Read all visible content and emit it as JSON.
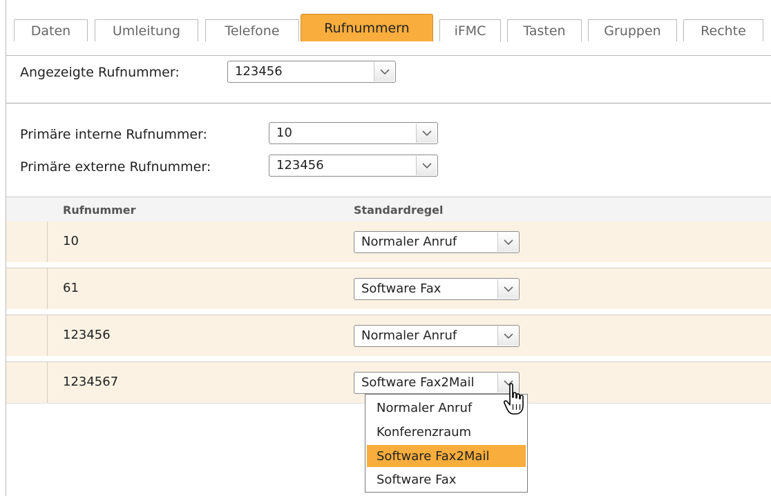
{
  "tabs": [
    {
      "label": "Daten"
    },
    {
      "label": "Umleitung"
    },
    {
      "label": "Telefone"
    },
    {
      "label": "Rufnummern",
      "active": true
    },
    {
      "label": "iFMC"
    },
    {
      "label": "Tasten"
    },
    {
      "label": "Gruppen"
    },
    {
      "label": "Rechte"
    }
  ],
  "displayed": {
    "label": "Angezeigte Rufnummer:",
    "value": "123456"
  },
  "primary_internal": {
    "label": "Primäre interne Rufnummer:",
    "value": "10"
  },
  "primary_external": {
    "label": "Primäre externe Rufnummer:",
    "value": "123456"
  },
  "table": {
    "headers": {
      "number": "Rufnummer",
      "rule": "Standardregel"
    },
    "rows": [
      {
        "number": "10",
        "rule": "Normaler Anruf"
      },
      {
        "number": "61",
        "rule": "Software Fax"
      },
      {
        "number": "123456",
        "rule": "Normaler Anruf"
      },
      {
        "number": "1234567",
        "rule": "Software Fax2Mail"
      }
    ]
  },
  "dropdown": {
    "options": [
      "Normaler Anruf",
      "Konferenzraum",
      "Software Fax2Mail",
      "Software Fax"
    ],
    "selected": "Software Fax2Mail"
  },
  "colors": {
    "accent": "#f9ad3c",
    "row_bg": "#fbf2e3"
  },
  "icons": {
    "select_arrow": "chevron-down-icon",
    "cursor": "hand-pointer-icon"
  }
}
